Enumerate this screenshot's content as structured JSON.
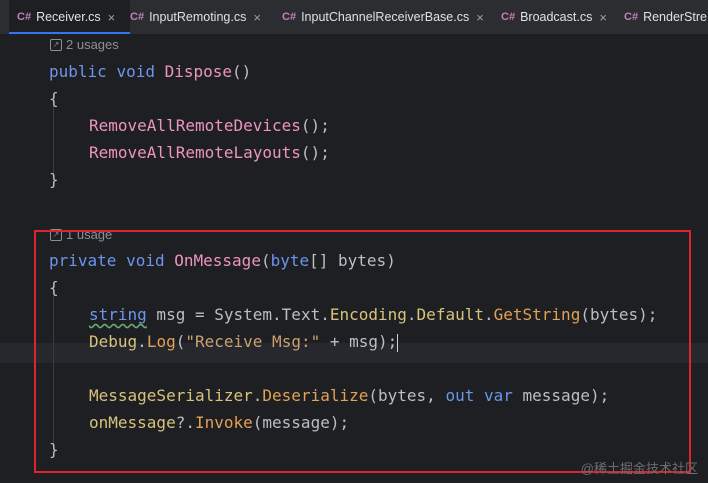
{
  "tabs": [
    {
      "icon": "C#",
      "label": "Receiver.cs",
      "close": "×",
      "active": true
    },
    {
      "icon": "C#",
      "label": "InputRemoting.cs",
      "close": "×"
    },
    {
      "icon": "C#",
      "label": "InputChannelReceiverBase.cs",
      "close": "×"
    },
    {
      "icon": "C#",
      "label": "Broadcast.cs",
      "close": "×"
    },
    {
      "icon": "C#",
      "label": "RenderStre"
    }
  ],
  "hints": {
    "dispose_usages": "2 usages",
    "onmessage_usages": "1 usage"
  },
  "code": {
    "l1": {
      "kw1": "public",
      "kw2": "void",
      "name": "Dispose",
      "rest": "()"
    },
    "l2": "{",
    "l3": {
      "name": "RemoveAllRemoteDevices",
      "rest": "();"
    },
    "l4": {
      "name": "RemoveAllRemoteLayouts",
      "rest": "();"
    },
    "l5": "}",
    "l6": {
      "kw1": "private",
      "kw2": "void",
      "name": "OnMessage",
      "p1": "(",
      "type": "byte",
      "p2": "[] bytes)"
    },
    "l7": "{",
    "l8": {
      "type": "string",
      "t1": " msg = ",
      "ns1": "System",
      "d1": ".",
      "ns2": "Text",
      "d2": ".",
      "ns3": "Encoding",
      "d3": ".",
      "prop": "Default",
      "d4": ".",
      "call": "GetString",
      "tail": "(bytes);"
    },
    "l9": {
      "cls": "Debug",
      "dot": ".",
      "call": "Log",
      "p1": "(",
      "str": "\"Receive Msg:\"",
      "tail": " + msg);"
    },
    "l10": {
      "cls": "MessageSerializer",
      "dot": ".",
      "call": "Deserialize",
      "p1": "(bytes, ",
      "kw1": "out",
      "sp": " ",
      "kw2": "var",
      "tail": " message);"
    },
    "l11": {
      "ref": "onMessage",
      "op": "?.",
      "call": "Invoke",
      "tail": "(message);"
    },
    "l12": "}"
  },
  "watermark": "@稀土掘金技术社区",
  "colors": {
    "keyword": "#6c95eb",
    "method": "#ed94c0",
    "highlight_box": "#e0242b"
  }
}
